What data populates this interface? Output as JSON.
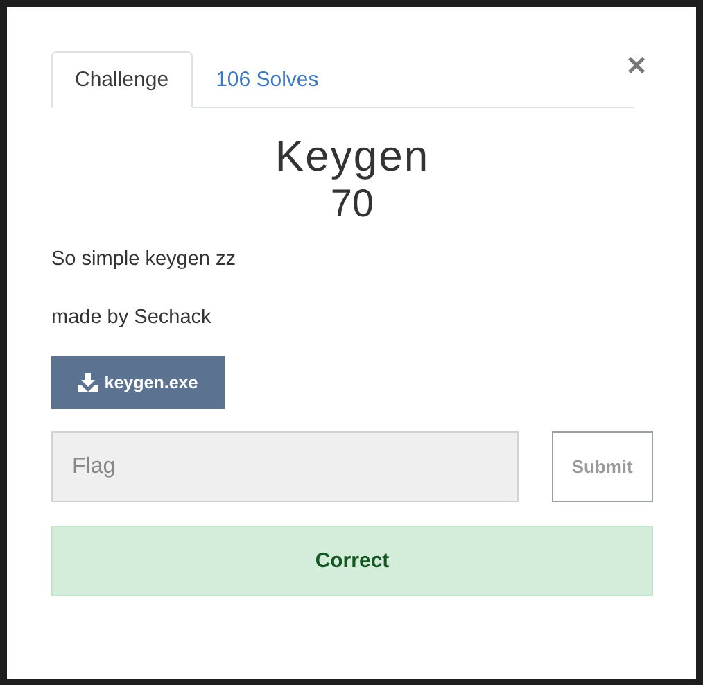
{
  "tabs": [
    {
      "label": "Challenge",
      "selected": true
    },
    {
      "label": "106 Solves",
      "selected": false
    }
  ],
  "close": "×",
  "challenge": {
    "name": "Keygen",
    "value": "70",
    "description": [
      "So simple keygen zz",
      "made by Sechack"
    ],
    "files": [
      "keygen.exe"
    ]
  },
  "flag": {
    "placeholder": "Flag"
  },
  "submit": "Submit",
  "result": {
    "kind": "success",
    "text": "Correct"
  }
}
